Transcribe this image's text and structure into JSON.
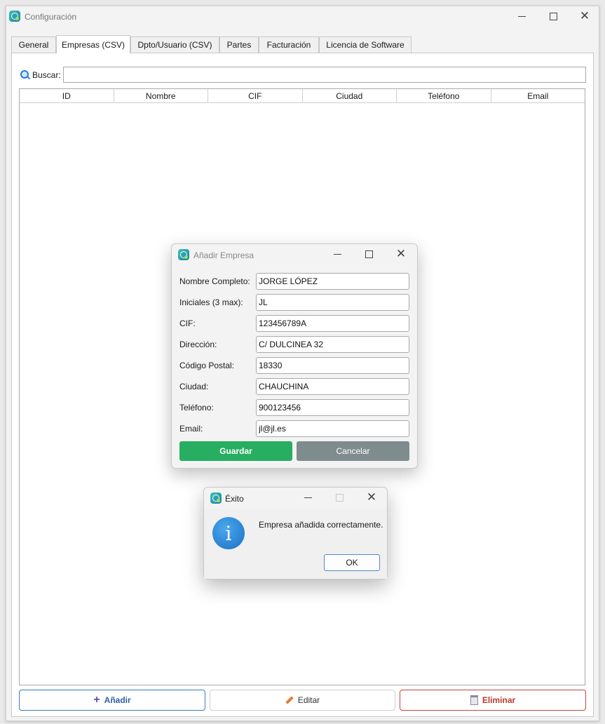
{
  "main_window": {
    "title": "Configuración",
    "tabs": [
      {
        "label": "General"
      },
      {
        "label": "Empresas (CSV)"
      },
      {
        "label": "Dpto/Usuario (CSV)"
      },
      {
        "label": "Partes"
      },
      {
        "label": "Facturación"
      },
      {
        "label": "Licencia de Software"
      }
    ],
    "active_tab": "Empresas (CSV)",
    "search": {
      "label": "Buscar:",
      "value": ""
    },
    "table": {
      "columns": [
        "ID",
        "Nombre",
        "CIF",
        "Ciudad",
        "Teléfono",
        "Email"
      ],
      "rows": []
    },
    "buttons": {
      "add": "Añadir",
      "edit": "Editar",
      "delete": "Eliminar"
    }
  },
  "add_dialog": {
    "title": "Añadir Empresa",
    "fields": [
      {
        "label": "Nombre Completo:",
        "value": "JORGE LÓPEZ"
      },
      {
        "label": "Iniciales (3 max):",
        "value": "JL"
      },
      {
        "label": "CIF:",
        "value": "123456789A"
      },
      {
        "label": "Dirección:",
        "value": "C/ DULCINEA 32"
      },
      {
        "label": "Código Postal:",
        "value": "18330"
      },
      {
        "label": "Ciudad:",
        "value": "CHAUCHINA"
      },
      {
        "label": "Teléfono:",
        "value": "900123456"
      },
      {
        "label": "Email:",
        "value": "jl@jl.es"
      }
    ],
    "save_label": "Guardar",
    "cancel_label": "Cancelar"
  },
  "message_box": {
    "title": "Éxito",
    "icon": "info-icon",
    "message": "Empresa añadida correctamente.",
    "ok_label": "OK"
  },
  "colors": {
    "save": "#27ae60",
    "cancel": "#7f8c8d",
    "add_border": "#3a79c4",
    "delete_border": "#c6443b",
    "info_icon": "#1b6fc4"
  }
}
